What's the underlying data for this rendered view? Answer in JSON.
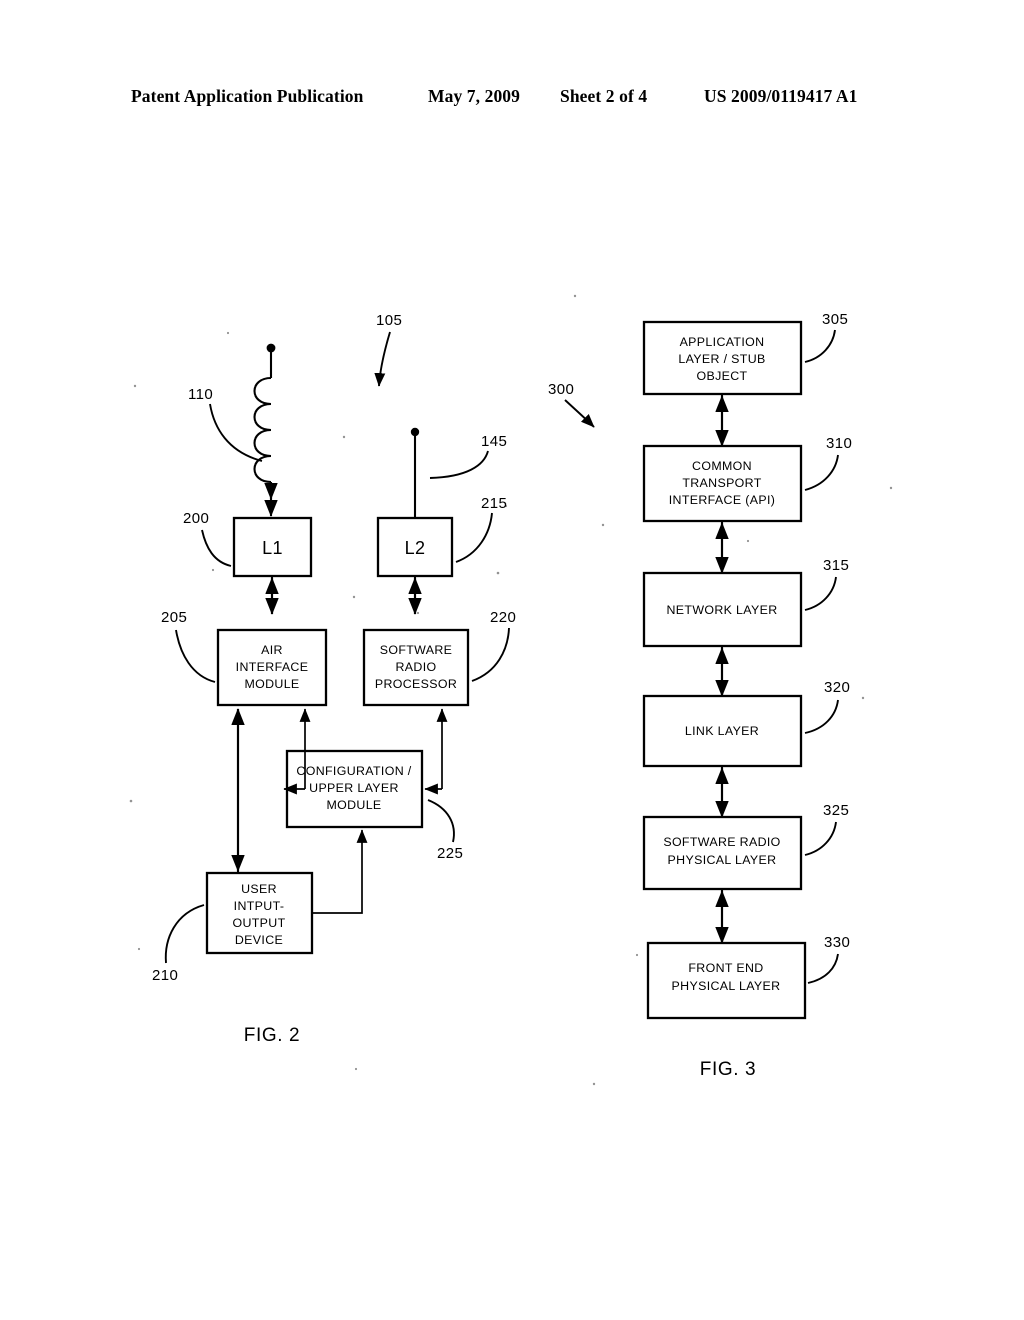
{
  "header": {
    "publication": "Patent Application Publication",
    "date": "May 7, 2009",
    "sheet": "Sheet 2 of 4",
    "patent_number": "US 2009/0119417 A1"
  },
  "figures": [
    {
      "caption": "FIG. 2",
      "overall_ref": "105",
      "boxes": [
        {
          "ref": "200",
          "lines": [
            "L1"
          ]
        },
        {
          "ref": "215",
          "lines": [
            "L2"
          ]
        },
        {
          "ref": "205",
          "lines": [
            "AIR",
            "INTERFACE",
            "MODULE"
          ]
        },
        {
          "ref": "220",
          "lines": [
            "SOFTWARE",
            "RADIO",
            "PROCESSOR"
          ]
        },
        {
          "ref": "225",
          "lines": [
            "CONFIGURATION /",
            "UPPER LAYER",
            "MODULE"
          ]
        },
        {
          "ref": "210",
          "lines": [
            "USER",
            "INTPUT-",
            "OUTPUT",
            "DEVICE"
          ]
        }
      ],
      "antennas": [
        {
          "ref": "110",
          "type": "coil-antenna"
        },
        {
          "ref": "145",
          "type": "whip-antenna"
        }
      ]
    },
    {
      "caption": "FIG. 3",
      "overall_ref": "300",
      "boxes": [
        {
          "ref": "305",
          "lines": [
            "APPLICATION",
            "LAYER / STUB",
            "OBJECT"
          ]
        },
        {
          "ref": "310",
          "lines": [
            "COMMON",
            "TRANSPORT",
            "INTERFACE (API)"
          ]
        },
        {
          "ref": "315",
          "lines": [
            "NETWORK LAYER"
          ]
        },
        {
          "ref": "320",
          "lines": [
            "LINK LAYER"
          ]
        },
        {
          "ref": "325",
          "lines": [
            "SOFTWARE RADIO",
            "PHYSICAL LAYER"
          ]
        },
        {
          "ref": "330",
          "lines": [
            "FRONT END",
            "PHYSICAL LAYER"
          ]
        }
      ]
    }
  ],
  "colors": {
    "ink": "#000000",
    "paper": "#ffffff"
  }
}
